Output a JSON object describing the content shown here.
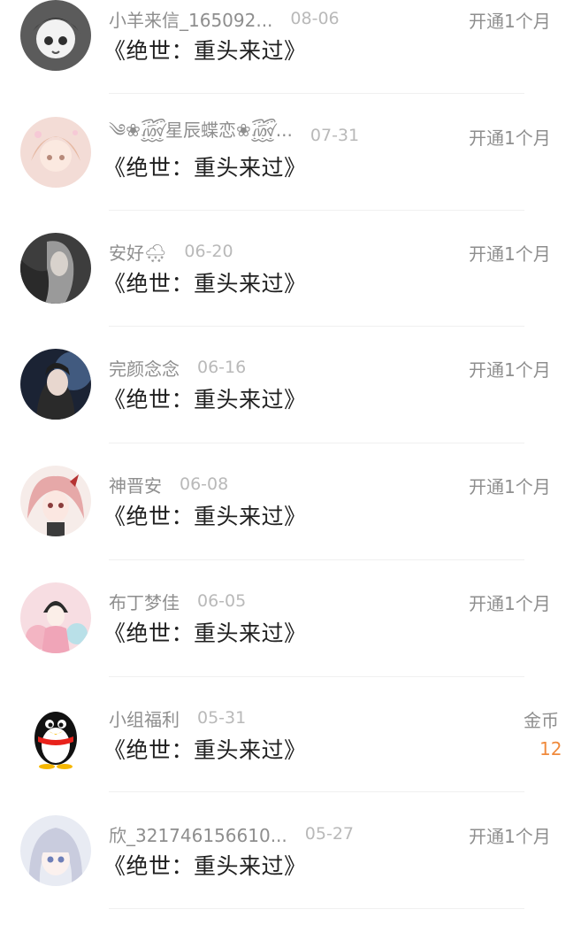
{
  "messages": [
    {
      "name": "小羊来信_165092...",
      "date": "08-06",
      "title": "《绝世：重头来过》",
      "action": "开通1个月",
      "avatar_icon": "anime-girl-avatar-icon"
    },
    {
      "name": "༄❀꫞星辰蝶恋❀꫞...",
      "date": "07-31",
      "title": "《绝世：重头来过》",
      "action": "开通1个月",
      "avatar_icon": "pastel-anime-girl-avatar-icon"
    },
    {
      "name": "安好🌨",
      "date": "06-20",
      "title": "《绝世：重头来过》",
      "action": "开通1个月",
      "avatar_icon": "dark-portrait-avatar-icon"
    },
    {
      "name": "完颜念念",
      "date": "06-16",
      "title": "《绝世：重头来过》",
      "action": "开通1个月",
      "avatar_icon": "blue-portrait-avatar-icon"
    },
    {
      "name": "神晋安",
      "date": "06-08",
      "title": "《绝世：重头来过》",
      "action": "开通1个月",
      "avatar_icon": "pink-hair-avatar-icon"
    },
    {
      "name": "布丁梦佳",
      "date": "06-05",
      "title": "《绝世：重头来过》",
      "action": "开通1个月",
      "avatar_icon": "traditional-girl-avatar-icon"
    },
    {
      "name": "小组福利",
      "date": "05-31",
      "title": "《绝世：重头来过》",
      "action": "金币",
      "sub": "12",
      "avatar_icon": "penguin-avatar-icon"
    },
    {
      "name": "欣_321746156610...",
      "date": "05-27",
      "title": "《绝世：重头来过》",
      "action": "开通1个月",
      "avatar_icon": "silver-hair-avatar-icon"
    }
  ],
  "colors": {
    "accent": "#f08a3c",
    "divider": "#f0f0f0"
  }
}
